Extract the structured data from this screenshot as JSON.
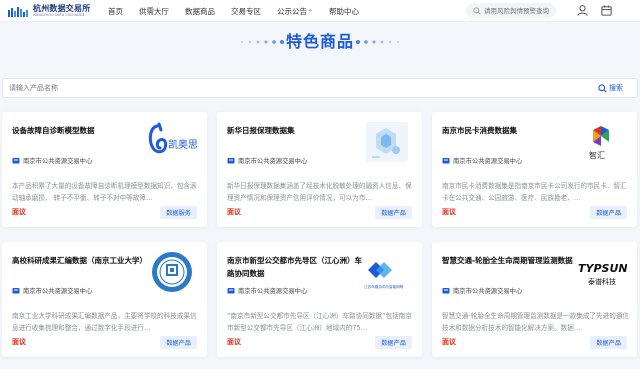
{
  "header": {
    "logo_cn": "杭州数据交易所",
    "logo_en": "HANGZHOU DATA EXCHANGE",
    "nav": [
      "首页",
      "供需大厅",
      "数据商品",
      "交易专区",
      "公示公告",
      "帮助中心"
    ],
    "search_placeholder": "请用风险舆情预警查询",
    "icons": [
      "search-icon",
      "user-icon",
      "cart-icon"
    ]
  },
  "page": {
    "title": "特色商品",
    "search_placeholder": "请输入产品名称",
    "search_button": "搜索"
  },
  "colors": {
    "accent": "#1e5bd8",
    "price": "#e0301e",
    "tag_bg": "#e8f0fe"
  },
  "cards": [
    {
      "title": "设备故障自诊断模型数据",
      "provider": "南京市公共资源交易中心",
      "desc": "本产品积累了大量的设备故障自诊断机理模型数据知识，包含滚动轴承磨损、 转子不平衡、转子不对中等故障…",
      "price": "面议",
      "tag": "数据服务",
      "logo_text": "凯奥思",
      "logo_icon": "kaos-logo-icon"
    },
    {
      "title": "新华日报保理数据集",
      "provider": "南京市公共资源交易中心",
      "desc": "新华日报保理数据集涵盖了经技术化脱敏处理的融资人信息、保理资产情况和保理资产信用评价情况，可以为市…",
      "price": "面议",
      "tag": "数据产品",
      "logo_text": "",
      "logo_icon": "xinhua-logo-icon"
    },
    {
      "title": "南京市民卡消费数据集",
      "provider": "南京市公共资源交易中心",
      "desc": "南京市民卡消费数据集是指南京市民卡公司发行的市民卡、智汇卡在公共交通、公园旅游、医疗、民族勘老、…",
      "price": "面议",
      "tag": "数据产品",
      "logo_text": "智汇",
      "logo_icon": "zhihui-logo-icon"
    },
    {
      "title": "高校科研成果汇编数据（南京工业大学）",
      "provider": "南京市公共资源交易中心",
      "desc": "南京工业大学科研成果汇编数据产品，主要将学校的科技成果信息进行收集梳理和整合，通过数字化手段进行…",
      "price": "面议",
      "tag": "数据产品",
      "logo_text": "",
      "logo_icon": "njtech-logo-icon"
    },
    {
      "title": "南京市新型公交都市先导区（江心洲）车路协同数据",
      "provider": "南京市公共资源交易中心",
      "desc": "“南京市新型公交都市先导区（江心洲）车路协同数据”包括南京市新型公交都市先导区（江心洲）地域内的75…",
      "price": "面议",
      "tag": "数据产品",
      "logo_text": "江苏车路协同与智能网联",
      "logo_icon": "v2x-logo-icon"
    },
    {
      "title": "智慧交通-轮胎全生命周期管理监测数据",
      "provider": "南京市公共资源交易中心",
      "desc": "智慧交通-轮胎全生命周期管理监测数据是一款集成了先进的通信技术和数据分析技术的智能化解决方案。数据…",
      "price": "面议",
      "tag": "数据产品",
      "logo_text": "TYPSUN",
      "logo_sub": "泰谱科技",
      "logo_icon": "typsun-logo-icon"
    }
  ]
}
